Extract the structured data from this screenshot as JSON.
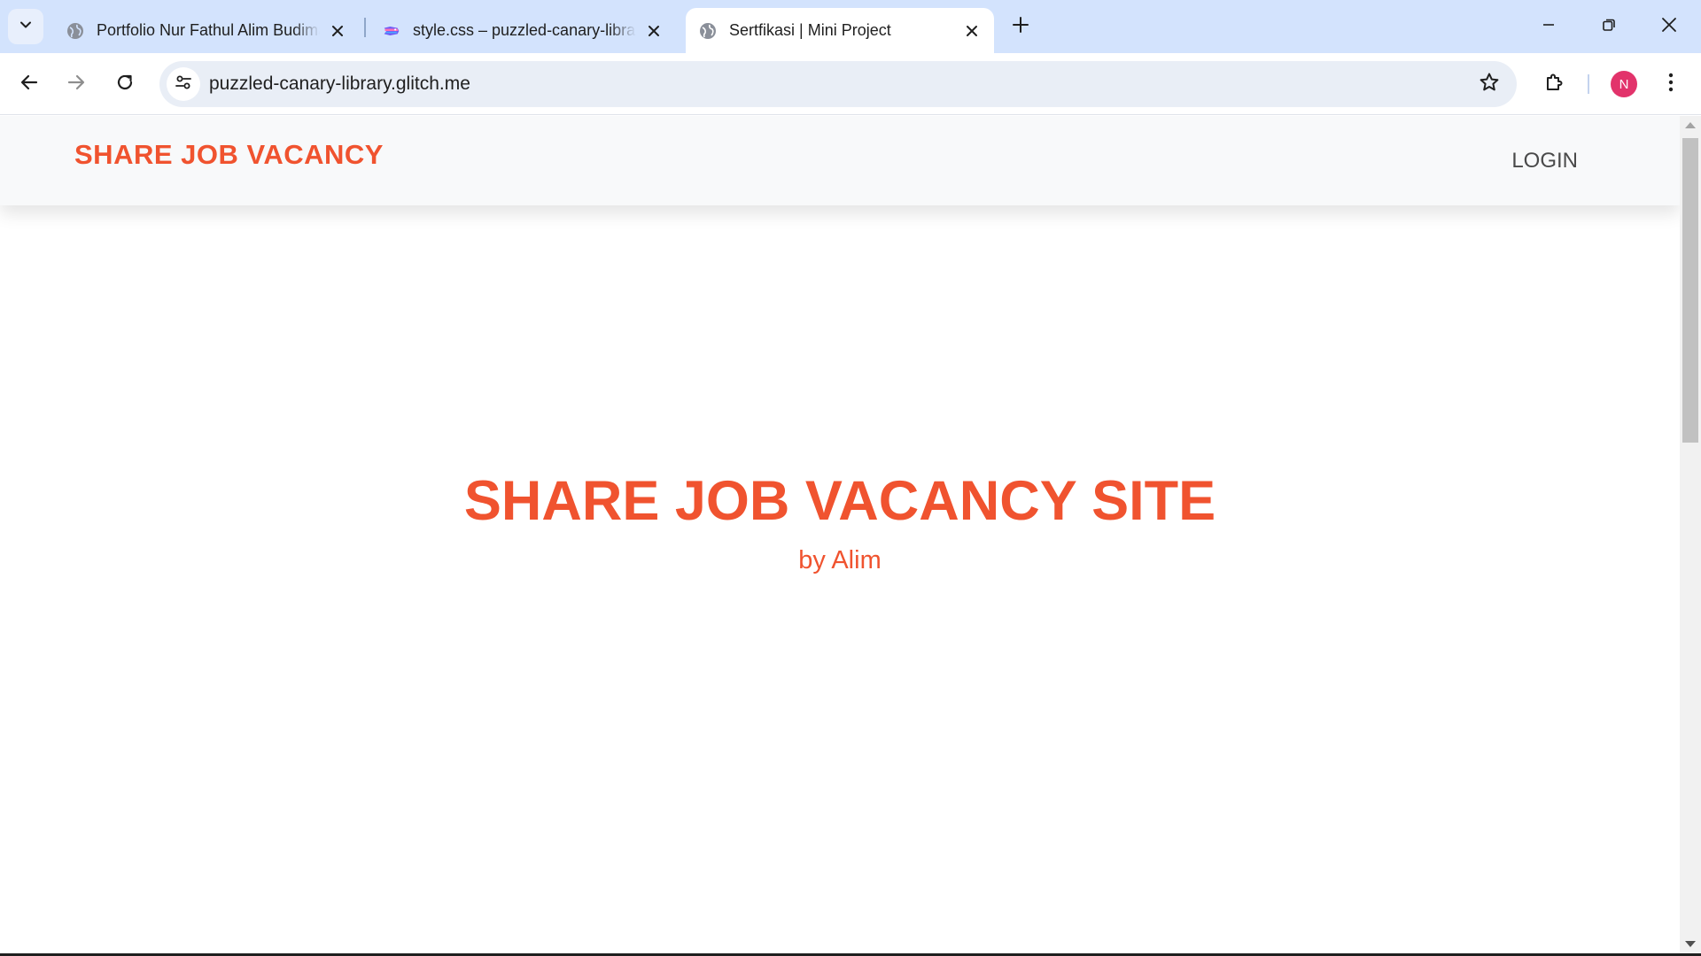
{
  "browser": {
    "tabs": [
      {
        "title": "Portfolio Nur Fathul Alim Budiman",
        "favicon": "globe-icon"
      },
      {
        "title": "style.css – puzzled-canary-library",
        "favicon": "glitch-fish-icon"
      },
      {
        "title": "Sertfikasi | Mini Project",
        "favicon": "globe-icon",
        "active": true
      }
    ],
    "url": "puzzled-canary-library.glitch.me",
    "profile_initial": "N",
    "profile_color": "#e2336b",
    "tabstrip_color": "#d3e3fd"
  },
  "page": {
    "navbar": {
      "brand": "SHARE JOB VACANCY",
      "login": "LOGIN"
    },
    "hero": {
      "title": "SHARE JOB VACANCY SITE",
      "subtitle": "by Alim"
    },
    "accent_color": "#f0532f"
  }
}
